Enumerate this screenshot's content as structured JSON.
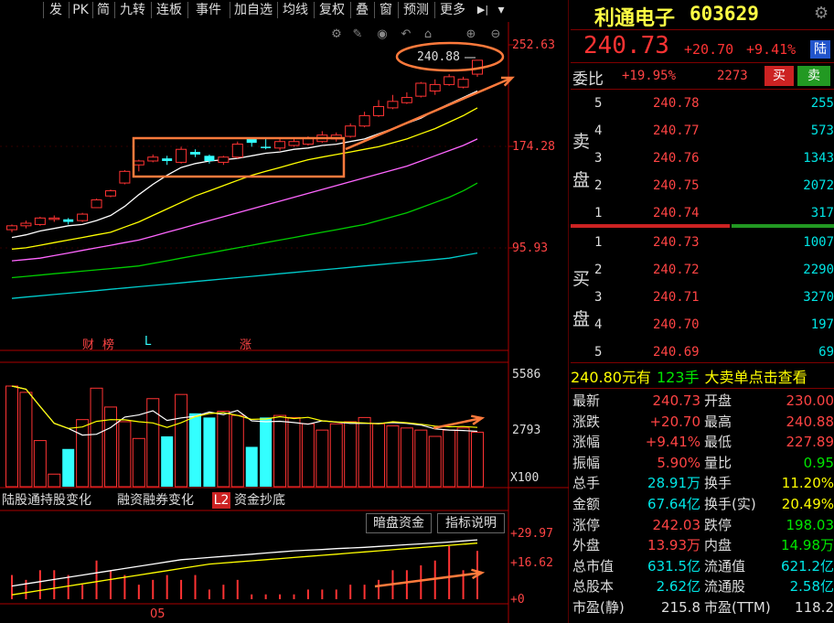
{
  "toolbar": {
    "items": [
      "发",
      "PK",
      "简",
      "九转",
      "连板",
      "事件",
      "加自选",
      "均线",
      "复权",
      "叠",
      "窗",
      "预测",
      "更多"
    ],
    "play_icon": "step-forward-icon",
    "dropdown_icon": "chevron-down-icon"
  },
  "chart_tools": [
    "gear-icon",
    "pen-icon",
    "eye-icon",
    "undo-icon",
    "lock-icon",
    "zoom-in-icon",
    "zoom-out-icon"
  ],
  "price_axis": {
    "top": "252.63",
    "mid": "174.28",
    "low": "95.93"
  },
  "volume_axis": {
    "top": "5586",
    "mid": "2793",
    "bottom": "X100"
  },
  "indicator_axis": {
    "top": "+29.97",
    "mid": "+16.62",
    "bottom": "+0"
  },
  "high_label": "240.88",
  "event_markers": {
    "m1": "财",
    "m2": "榜",
    "m3": "L",
    "m4": "涨"
  },
  "bottom_tabs": [
    "陆股通持股变化",
    "融资融券变化",
    "L2",
    "资金抄底"
  ],
  "indicator_buttons": {
    "b1": "暗盘资金",
    "b2": "指标说明"
  },
  "date_label": "05",
  "colors": {
    "up": "#ff3333",
    "down": "#33ffff",
    "ma5": "#ffffff",
    "ma10": "#ffff00",
    "ma20": "#ff66ff",
    "ma60": "#00cc00",
    "ma120": "#00cccc",
    "annotation": "#ff7a3c"
  },
  "chart_data": {
    "type": "candlestick",
    "ylim": [
      95.93,
      252.63
    ],
    "candles": [
      {
        "o": 110,
        "c": 113,
        "h": 114,
        "l": 108
      },
      {
        "o": 113,
        "c": 115,
        "h": 117,
        "l": 111
      },
      {
        "o": 114,
        "c": 119,
        "h": 120,
        "l": 113
      },
      {
        "o": 119,
        "c": 119,
        "h": 121,
        "l": 116
      },
      {
        "o": 118,
        "c": 116,
        "h": 119,
        "l": 114
      },
      {
        "o": 117,
        "c": 122,
        "h": 123,
        "l": 116
      },
      {
        "o": 127,
        "c": 133,
        "h": 134,
        "l": 127
      },
      {
        "o": 136,
        "c": 140,
        "h": 141,
        "l": 135
      },
      {
        "o": 146,
        "c": 155,
        "h": 156,
        "l": 145
      },
      {
        "o": 160,
        "c": 163,
        "h": 164,
        "l": 155
      },
      {
        "o": 163,
        "c": 166,
        "h": 168,
        "l": 162
      },
      {
        "o": 165,
        "c": 163,
        "h": 167,
        "l": 160
      },
      {
        "o": 162,
        "c": 172,
        "h": 174,
        "l": 161
      },
      {
        "o": 170,
        "c": 168,
        "h": 172,
        "l": 166
      },
      {
        "o": 167,
        "c": 163,
        "h": 168,
        "l": 161
      },
      {
        "o": 162,
        "c": 166,
        "h": 167,
        "l": 160
      },
      {
        "o": 166,
        "c": 176,
        "h": 178,
        "l": 165
      },
      {
        "o": 180,
        "c": 177,
        "h": 181,
        "l": 174
      },
      {
        "o": 174,
        "c": 173,
        "h": 180,
        "l": 172
      },
      {
        "o": 173,
        "c": 178,
        "h": 180,
        "l": 171
      },
      {
        "o": 175,
        "c": 178,
        "h": 181,
        "l": 174
      },
      {
        "o": 176,
        "c": 181,
        "h": 182,
        "l": 175
      },
      {
        "o": 178,
        "c": 183,
        "h": 186,
        "l": 177
      },
      {
        "o": 180,
        "c": 183,
        "h": 185,
        "l": 178
      },
      {
        "o": 182,
        "c": 190,
        "h": 192,
        "l": 181
      },
      {
        "o": 190,
        "c": 198,
        "h": 201,
        "l": 189
      },
      {
        "o": 198,
        "c": 205,
        "h": 210,
        "l": 197
      },
      {
        "o": 204,
        "c": 209,
        "h": 214,
        "l": 203
      },
      {
        "o": 208,
        "c": 212,
        "h": 216,
        "l": 207
      },
      {
        "o": 213,
        "c": 223,
        "h": 224,
        "l": 212
      },
      {
        "o": 217,
        "c": 222,
        "h": 226,
        "l": 214
      },
      {
        "o": 222,
        "c": 228,
        "h": 230,
        "l": 221
      },
      {
        "o": 220,
        "c": 226,
        "h": 228,
        "l": 219
      },
      {
        "o": 230,
        "c": 240.73,
        "h": 240.88,
        "l": 227.89
      }
    ],
    "ma": [
      {
        "name": "ma5",
        "values": [
          104,
          106,
          109,
          111,
          113,
          114,
          117,
          121,
          128,
          137,
          145,
          152,
          158,
          161,
          163,
          164,
          165,
          167,
          169,
          170,
          172,
          173,
          175,
          176,
          178,
          180,
          184,
          188,
          192,
          196,
          202,
          207,
          212,
          217
        ]
      },
      {
        "name": "ma10",
        "values": [
          95,
          96,
          98,
          100,
          102,
          104,
          106,
          108,
          112,
          116,
          121,
          126,
          131,
          136,
          140,
          144,
          148,
          152,
          155,
          158,
          161,
          164,
          166,
          168,
          170,
          172,
          174,
          177,
          180,
          184,
          188,
          193,
          198,
          204
        ]
      },
      {
        "name": "ma20",
        "values": [
          86,
          87,
          88,
          90,
          92,
          94,
          96,
          98,
          100,
          102,
          105,
          108,
          111,
          114,
          117,
          120,
          123,
          126,
          129,
          132,
          135,
          138,
          141,
          144,
          147,
          150,
          153,
          156,
          159,
          163,
          167,
          171,
          175,
          180
        ]
      },
      {
        "name": "ma60",
        "values": [
          73,
          74,
          75,
          76,
          77,
          78,
          79,
          80,
          81,
          82,
          84,
          86,
          88,
          90,
          92,
          94,
          96,
          98,
          100,
          102,
          104,
          106,
          108,
          110,
          112,
          114,
          117,
          120,
          123,
          127,
          131,
          135,
          140,
          146
        ]
      },
      {
        "name": "ma120",
        "values": [
          57,
          58,
          59,
          60,
          61,
          62,
          63,
          64,
          65,
          66,
          67,
          68,
          69,
          70,
          71,
          72,
          73,
          74,
          75,
          76,
          77,
          78,
          79,
          80,
          81,
          82,
          83,
          84,
          85,
          86,
          87,
          88,
          90,
          92
        ]
      }
    ],
    "volume": [
      4800,
      4500,
      2200,
      600,
      1800,
      3200,
      4700,
      3800,
      3100,
      2300,
      4200,
      2400,
      4400,
      3500,
      3300,
      3600,
      3400,
      1900,
      3300,
      3400,
      3300,
      3000,
      2700,
      3000,
      3100,
      3300,
      3000,
      2900,
      2800,
      2700,
      2400,
      2700,
      2800,
      2600
    ]
  },
  "right_panel": {
    "stock_name": "利通电子",
    "stock_code": "603629",
    "settings_icon": "gear-icon",
    "price": "240.73",
    "change": "+20.70",
    "change_pct": "+9.41%",
    "market_tag": "陆",
    "ratio_label": "委比",
    "ratio_value": "+19.95%",
    "ratio_diff": "2273",
    "buy_btn": "买",
    "sell_btn": "卖",
    "sell_side_label": [
      "卖",
      "盘"
    ],
    "buy_side_label": [
      "买",
      "盘"
    ],
    "asks": [
      {
        "lv": "5",
        "price": "240.78",
        "vol": "255"
      },
      {
        "lv": "4",
        "price": "240.77",
        "vol": "573"
      },
      {
        "lv": "3",
        "price": "240.76",
        "vol": "1343"
      },
      {
        "lv": "2",
        "price": "240.75",
        "vol": "2072"
      },
      {
        "lv": "1",
        "price": "240.74",
        "vol": "317"
      }
    ],
    "bids": [
      {
        "lv": "1",
        "price": "240.73",
        "vol": "1007"
      },
      {
        "lv": "2",
        "price": "240.72",
        "vol": "2290"
      },
      {
        "lv": "3",
        "price": "240.71",
        "vol": "3270"
      },
      {
        "lv": "4",
        "price": "240.70",
        "vol": "197"
      },
      {
        "lv": "5",
        "price": "240.69",
        "vol": "69"
      }
    ],
    "big_order": {
      "price": "240.80元有",
      "vol": "123手",
      "text": "大卖单",
      "link": "点击查看"
    },
    "stats": [
      {
        "k1": "最新",
        "v1": "240.73",
        "c1": "red",
        "k2": "开盘",
        "v2": "230.00",
        "c2": "red"
      },
      {
        "k1": "涨跌",
        "v1": "+20.70",
        "c1": "red",
        "k2": "最高",
        "v2": "240.88",
        "c2": "red"
      },
      {
        "k1": "涨幅",
        "v1": "+9.41%",
        "c1": "red",
        "k2": "最低",
        "v2": "227.89",
        "c2": "red"
      },
      {
        "k1": "振幅",
        "v1": "5.90%",
        "c1": "red",
        "k2": "量比",
        "v2": "0.95",
        "c2": "green"
      },
      {
        "k1": "总手",
        "v1": "28.91万",
        "c1": "cyan",
        "k2": "换手",
        "v2": "11.20%",
        "c2": "yellow"
      },
      {
        "k1": "金额",
        "v1": "67.64亿",
        "c1": "cyan",
        "k2": "换手(实)",
        "v2": "20.49%",
        "c2": "yellow"
      },
      {
        "k1": "涨停",
        "v1": "242.03",
        "c1": "red",
        "k2": "跌停",
        "v2": "198.03",
        "c2": "green"
      },
      {
        "k1": "外盘",
        "v1": "13.93万",
        "c1": "red",
        "k2": "内盘",
        "v2": "14.98万",
        "c2": "green"
      },
      {
        "k1": "总市值",
        "v1": "631.5亿",
        "c1": "cyan",
        "k2": "流通值",
        "v2": "621.2亿",
        "c2": "cyan"
      },
      {
        "k1": "总股本",
        "v1": "2.62亿",
        "c1": "cyan",
        "k2": "流通股",
        "v2": "2.58亿",
        "c2": "cyan"
      },
      {
        "k1": "市盈(静)",
        "v1": "215.8",
        "c1": "white",
        "k2": "市盈(TTM)",
        "v2": "118.2",
        "c2": "white"
      }
    ]
  }
}
